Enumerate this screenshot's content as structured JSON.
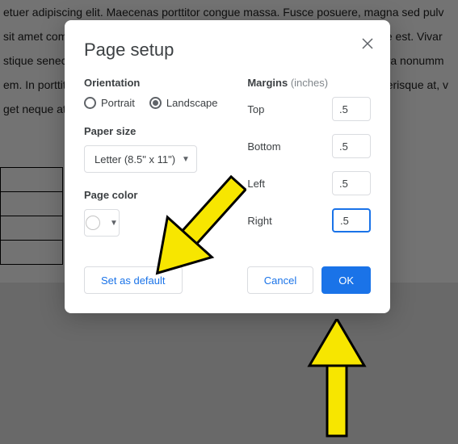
{
  "background": {
    "lines": [
      "etuer adipiscing elit. Maecenas porttitor congue massa. Fusce posuere, magna sed pulv",
      " sit amet commodo magna eros quis urna. Nunc viverra imperdiet enim. Fusce est. Vivar",
      "stique senectus et netus et malesuada fames ac turpis egestas. Proin pharetra nonumm",
      "em. In porttitor. Donec laoreet nonummy augue. Suspendisse dui purus, scelerisque at, v",
      "get neque at sem venenatis eleifend. Ut nonummy."
    ]
  },
  "dialog": {
    "title": "Page setup",
    "orientation_label": "Orientation",
    "portrait_label": "Portrait",
    "landscape_label": "Landscape",
    "orientation_selected": "landscape",
    "paper_size_label": "Paper size",
    "paper_size_value": "Letter (8.5\" x 11\")",
    "page_color_label": "Page color",
    "page_color_value": "#ffffff",
    "margins_label": "Margins",
    "margins_unit": "(inches)",
    "margins": {
      "top_label": "Top",
      "top_value": ".5",
      "bottom_label": "Bottom",
      "bottom_value": ".5",
      "left_label": "Left",
      "left_value": ".5",
      "right_label": "Right",
      "right_value": ".5"
    },
    "buttons": {
      "set_default": "Set as default",
      "cancel": "Cancel",
      "ok": "OK"
    }
  },
  "annotations": {
    "arrow1_target": "set-as-default-button",
    "arrow2_target": "ok-button"
  }
}
